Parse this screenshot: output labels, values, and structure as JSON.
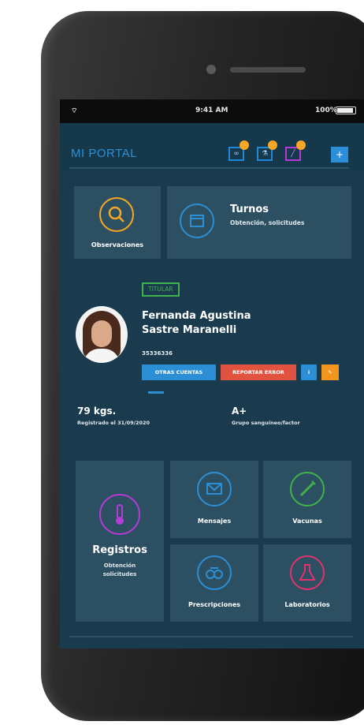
{
  "status_bar": {
    "time": "9:41 AM",
    "battery": "100%"
  },
  "header": {
    "title": "MI PORTAL",
    "add_label": "+"
  },
  "tiles": {
    "observaciones": "Observaciones",
    "turnos_title": "Turnos",
    "turnos_sub": "Obtención, solicitudes"
  },
  "profile": {
    "badge": "TITULAR",
    "name_line1": "Fernanda Agustina",
    "name_line2": "Sastre Maranelli",
    "id": "35336336",
    "btn_primary": "OTRAS CUENTAS",
    "btn_secondary": "REPORTAR ERROR",
    "info_label": "i",
    "edit_label": "✎"
  },
  "stats": {
    "weight": "79 kgs.",
    "weight_sub": "Registrado el 31/09/2020",
    "blood": "A+",
    "blood_sub": "Grupo sanguíneo/factor"
  },
  "grid": {
    "registros_title": "Registros",
    "registros_sub_1": "Obtención",
    "registros_sub_2": "solicitudes",
    "mensajes": "Mensajes",
    "vacunas": "Vacunas",
    "prescripciones": "Prescripciones",
    "laboratorios": "Laboratorios"
  },
  "colors": {
    "background": "#1a3a4d",
    "tile": "#2d4f62",
    "accent_blue": "#2c8fd6",
    "accent_orange": "#f5a623",
    "accent_green": "#3fb24a",
    "accent_red": "#e2533f",
    "accent_purple": "#b43bd6",
    "accent_pink": "#e0336e"
  }
}
